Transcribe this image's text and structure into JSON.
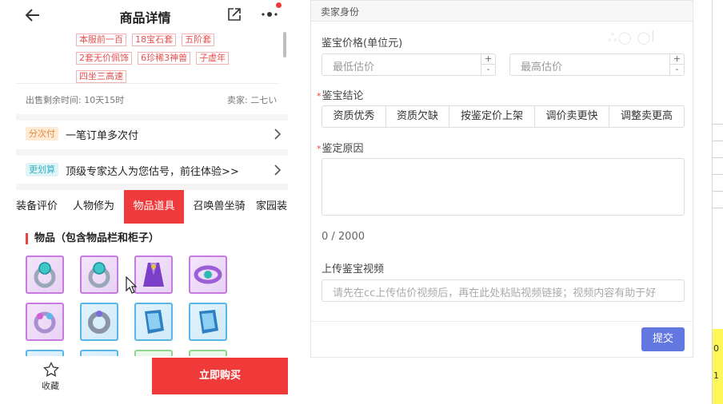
{
  "phone": {
    "title": "商品详情",
    "tags": [
      "本服前一百",
      "18宝石套",
      "五阶套",
      "2套无价佩饰",
      "6珍稀3神兽",
      "子虚年",
      "四坐三高速"
    ],
    "sale_time": "出售剩余时间: 10天15时",
    "seller": "卖家: 二七い",
    "installment": {
      "badge": "分次付",
      "text": "一笔订单多次付"
    },
    "valuation": {
      "badge": "更划算",
      "text": "顶级专家达人为您估号，前往体验>>"
    },
    "tabs": [
      {
        "label": "装备评价",
        "active": false
      },
      {
        "label": "人物修为",
        "active": false
      },
      {
        "label": "物品道具",
        "active": true
      },
      {
        "label": "召唤兽坐骑",
        "active": false
      },
      {
        "label": "家园装",
        "active": false
      }
    ],
    "section_title": "物品（包含物品栏和柜子）",
    "items": [
      {
        "icon": "ring-icon",
        "frame": "purple"
      },
      {
        "icon": "ring-icon",
        "frame": "purple"
      },
      {
        "icon": "robe-icon",
        "frame": "purple"
      },
      {
        "icon": "belt-icon",
        "frame": "purple"
      },
      {
        "icon": "accessory-icon",
        "frame": "purple"
      },
      {
        "icon": "bracelet-icon",
        "frame": "blue"
      },
      {
        "icon": "book-icon",
        "frame": "blue"
      },
      {
        "icon": "book-icon",
        "frame": "blue"
      },
      {
        "icon": "item-icon",
        "frame": "blue"
      },
      {
        "icon": "item-icon",
        "frame": "blue"
      },
      {
        "icon": "item-icon",
        "frame": "green"
      },
      {
        "icon": "item-icon",
        "frame": "green"
      }
    ],
    "favorite_label": "收藏",
    "buy_label": "立即购买",
    "colors": {
      "accent": "#f03a3a",
      "tag": "#e45050"
    }
  },
  "form": {
    "header": "卖家身份",
    "price_label": "鉴宝价格(单位元)",
    "min_placeholder": "最低估价",
    "max_placeholder": "最高估价",
    "stepper_plus": "+",
    "stepper_minus": "-",
    "required_mark": "*",
    "conclusion_label": "鉴宝结论",
    "conclusions": [
      "资质优秀",
      "资质欠缺",
      "按鉴定价上架",
      "调价卖更快",
      "调整卖更高"
    ],
    "reason_label": "鉴定原因",
    "counter": "0 / 2000",
    "video_label": "上传鉴宝视频",
    "video_placeholder": "请先在cc上传估价视频后，再在此处粘贴视频链接；视频内容有助于好",
    "submit_label": "提交",
    "colors": {
      "submit": "#6377e0"
    }
  },
  "edge": {
    "text_1": "0",
    "text_2": "1"
  }
}
